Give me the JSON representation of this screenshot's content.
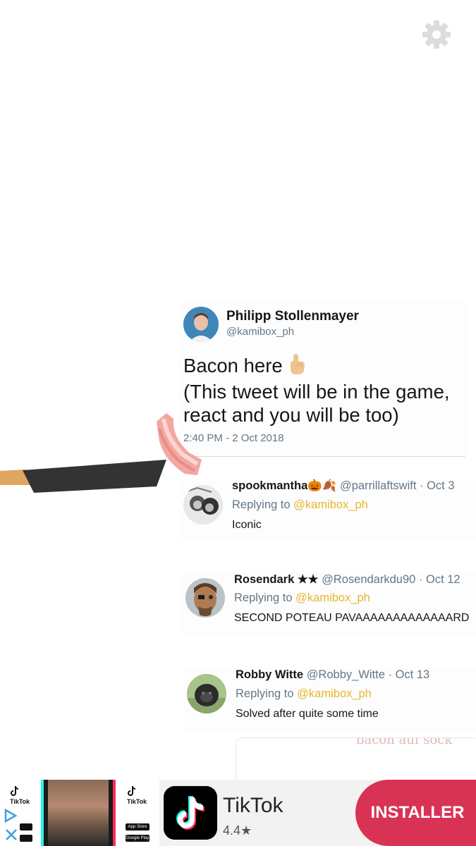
{
  "settings": {
    "icon": "gear-icon"
  },
  "tweet": {
    "author_name": "Philipp Stollenmayer",
    "author_handle": "@kamibox_ph",
    "text_lines": [
      "Bacon here",
      "(This tweet will be in the game,",
      "react and you will be too)"
    ],
    "emoji": "pointing-up-hand-icon",
    "timestamp": "2:40 PM - 2 Oct 2018"
  },
  "replies": [
    {
      "name": "spookmantha",
      "name_emoji": "🎃🍂",
      "handle": "@parrillaftswift",
      "date": "· Oct 3",
      "replying_prefix": "Replying to ",
      "replying_to": "@kamibox_ph",
      "text": "Iconic"
    },
    {
      "name": "Rosendark",
      "name_emoji": "★★",
      "handle": "@Rosendarkdu90",
      "date": "· Oct 12",
      "replying_prefix": "Replying to ",
      "replying_to": "@kamibox_ph",
      "text": "SECOND POTEAU PAVAAAAAAAAAAAAARD"
    },
    {
      "name": "Robby Witte",
      "name_emoji": "",
      "handle": "@Robby_Witte",
      "date": "· Oct 13",
      "replying_prefix": "Replying to ",
      "replying_to": "@kamibox_ph",
      "text": "Solved after quite some time"
    }
  ],
  "embed": {
    "partial_text": "bacon auf sock"
  },
  "ad": {
    "mini_brand": "TikTok",
    "badge_app_store": "App Store",
    "badge_google_play": "Google Play",
    "app_name": "TikTok",
    "rating": "4.4",
    "rating_star": "★",
    "install_label": "INSTALLER",
    "colors": {
      "install": "#d83355",
      "cyan": "#25f4ee",
      "pink": "#fe2c55"
    }
  },
  "colors": {
    "mention": "#e8b52c",
    "secondary_text": "#657786",
    "primary_text": "#14171a"
  }
}
